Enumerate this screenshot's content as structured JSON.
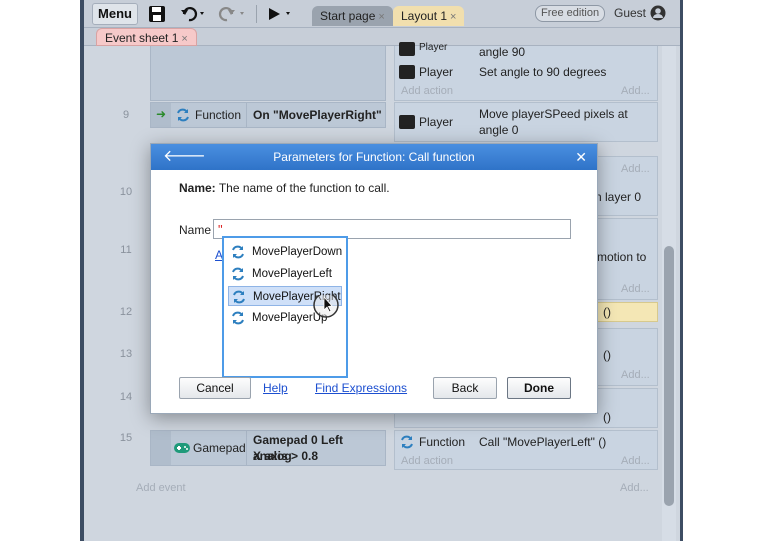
{
  "toolbar": {
    "menu": "Menu",
    "tabs": [
      {
        "label": "Start page",
        "close": "×"
      },
      {
        "label": "Layout 1",
        "close": "×"
      }
    ],
    "edition": "Free edition",
    "user": "Guest"
  },
  "subtabs": [
    {
      "label": "Event sheet 1",
      "close": "×"
    }
  ],
  "sheet": {
    "rows": [
      {
        "num": "9"
      },
      {
        "num": "10"
      },
      {
        "num": "11"
      },
      {
        "num": "12"
      },
      {
        "num": "13"
      },
      {
        "num": "14"
      },
      {
        "num": "15"
      }
    ],
    "top_player_partial": "Player",
    "top_action_partial": "angle 90",
    "top_player": "Player",
    "top_action": "Set angle to 90 degrees",
    "add_action": "Add action",
    "add": "Add...",
    "row9_cond_obj": "Function",
    "row9_cond": "On \"MovePlayerRight\"",
    "row9_player": "Player",
    "row9_action_line1": "Move playerSPeed pixels at",
    "row9_action_line2": "angle 0",
    "row10_partial": "n layer 0",
    "row11_partial": "motion to",
    "row12_partial": "()",
    "row13_partial": "()",
    "row14_partial": "()",
    "row15_cond_obj": "Gamepad",
    "row15_cond_line1": "Gamepad 0 Left analog",
    "row15_cond_line2": "X axis > 0.8",
    "row15_act_obj": "Function",
    "row15_action": "Call \"MovePlayerLeft\" ()",
    "add_event": "Add event"
  },
  "dialog": {
    "title": "Parameters for Function: Call function",
    "name_label_bold": "Name:",
    "name_desc": "The name of the function to call.",
    "field_label": "Name",
    "field_value": "\"",
    "hidden_link_partial": "A",
    "options": [
      "MovePlayerDown",
      "MovePlayerLeft",
      "MovePlayerRight",
      "MovePlayerUp"
    ],
    "selected_index": 2,
    "cancel": "Cancel",
    "help": "Help",
    "find_expressions": "Find Expressions",
    "back": "Back",
    "done": "Done"
  },
  "colors": {
    "titlebar": "#2f73c8",
    "selection": "#cfe0f8",
    "link": "#1c4fd0",
    "function_icon": "#2d7fbf",
    "gamepad_icon": "#1f9a7a"
  }
}
